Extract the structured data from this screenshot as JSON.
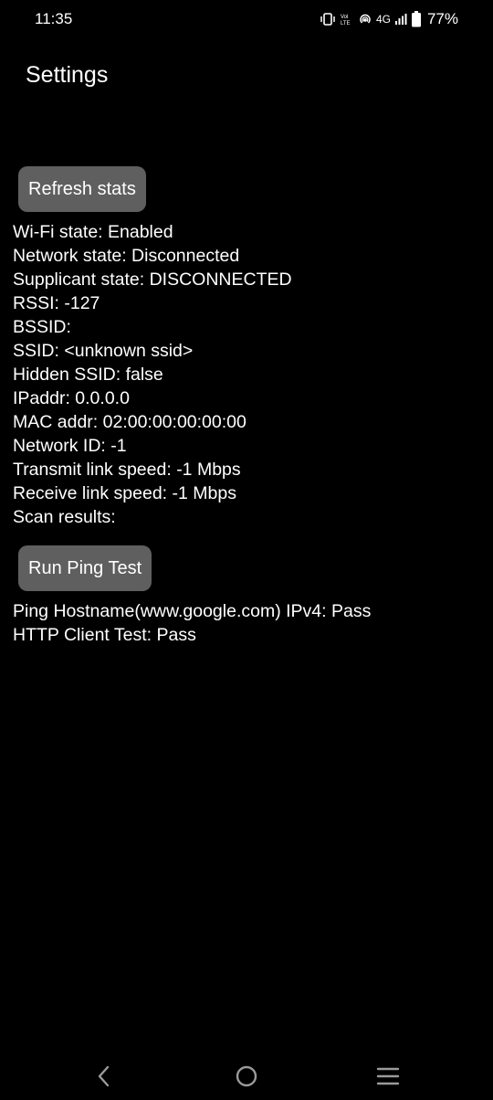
{
  "status_bar": {
    "time": "11:35",
    "network_type": "4G",
    "battery_percent": "77%",
    "icons": [
      "vibrate-icon",
      "volte-icon",
      "hotspot-icon",
      "signal-icon",
      "battery-icon"
    ]
  },
  "header": {
    "title": "Settings"
  },
  "actions": {
    "refresh_label": "Refresh stats",
    "ping_label": "Run Ping Test"
  },
  "stats": [
    {
      "key": "Wi-Fi state: ",
      "value": "Enabled"
    },
    {
      "key": "Network state: ",
      "value": "Disconnected"
    },
    {
      "key": "Supplicant state: ",
      "value": "DISCONNECTED"
    },
    {
      "key": "RSSI: ",
      "value": "-127"
    },
    {
      "key": "BSSID:",
      "value": ""
    },
    {
      "key": "SSID: ",
      "value": "<unknown ssid>"
    },
    {
      "key": "Hidden SSID: ",
      "value": "false"
    },
    {
      "key": "IPaddr: ",
      "value": "0.0.0.0"
    },
    {
      "key": "MAC addr: ",
      "value": "02:00:00:00:00:00"
    },
    {
      "key": "Network ID: ",
      "value": "-1"
    },
    {
      "key": "Transmit link speed: ",
      "value": "-1 Mbps"
    },
    {
      "key": "Receive link speed: ",
      "value": "-1 Mbps"
    },
    {
      "key": "Scan results:",
      "value": ""
    }
  ],
  "ping_results": [
    {
      "key": "Ping Hostname(www.google.com) IPv4: ",
      "value": "Pass"
    },
    {
      "key": "HTTP Client Test: ",
      "value": "Pass"
    }
  ],
  "nav": {
    "icons": [
      "back-icon",
      "home-icon",
      "recents-icon"
    ]
  },
  "colors": {
    "background": "#000000",
    "text": "#ffffff",
    "button": "#5f5f5f"
  }
}
